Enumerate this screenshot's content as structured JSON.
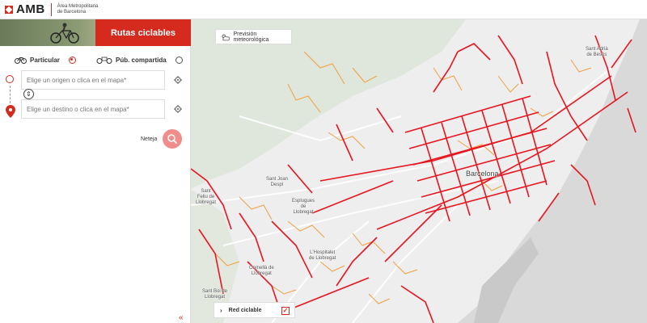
{
  "header": {
    "logo_text": "AMB",
    "logo_subtitle_line1": "Àrea Metropolitana",
    "logo_subtitle_line2": "de Barcelona"
  },
  "panel": {
    "title": "Rutas ciclables",
    "mode_private": "Particular",
    "mode_shared": "Púb. compartida",
    "origin_placeholder": "Elige un origen o clica en el mapa*",
    "destination_placeholder": "Elige un destino o clica en el mapa*",
    "clear_label": "Neteja",
    "collapse_label": "«"
  },
  "map": {
    "weather_button": "Previsión meteorológica",
    "legend_label": "Red ciclable",
    "labels": {
      "barcelona": "Barcelona",
      "sant_adria": "Sant Adrià\nde Besòs",
      "sant_joan": "Sant Joan\nDespí",
      "sant_feliu": "Sant\nFeliu de\nLlobregat",
      "esplugues": "Esplugues\nde\nLlobregat",
      "hospitalet": "L'Hospitalet\nde Llobregat",
      "cornella": "Cornellà de\nLlobregat",
      "sant_boi": "Sant Boi de\nLlobregat"
    }
  },
  "colors": {
    "brand_red": "#d52b1e",
    "bike_lane": "#e8141e",
    "bike_lane_secondary": "#f0a040",
    "sea": "#d9d9d9",
    "park": "#dfe6dc"
  }
}
